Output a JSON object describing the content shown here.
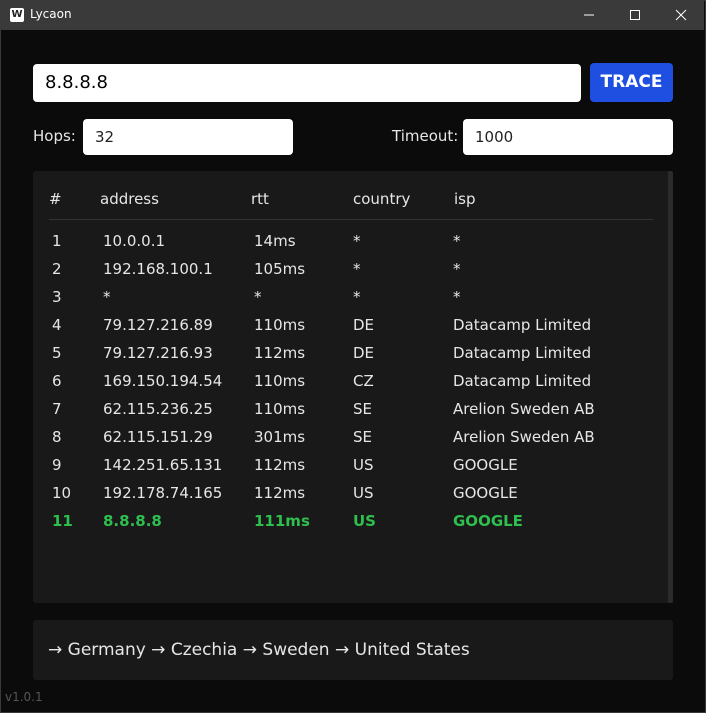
{
  "window": {
    "title": "Lycaon",
    "icon_letter": "W",
    "controls": [
      "minimize-icon",
      "maximize-icon",
      "close-icon"
    ]
  },
  "search": {
    "value": "8.8.8.8",
    "button_label": "TRACE"
  },
  "options": {
    "hops_label": "Hops:",
    "hops_value": "32",
    "timeout_label": "Timeout:",
    "timeout_value": "1000"
  },
  "table": {
    "headers": [
      "#",
      "address",
      "rtt",
      "country",
      "isp"
    ],
    "rows": [
      {
        "num": "1",
        "address": "10.0.0.1",
        "rtt": "14ms",
        "country": "*",
        "isp": "*"
      },
      {
        "num": "2",
        "address": "192.168.100.1",
        "rtt": "105ms",
        "country": "*",
        "isp": "*"
      },
      {
        "num": "3",
        "address": "*",
        "rtt": "*",
        "country": "*",
        "isp": "*"
      },
      {
        "num": "4",
        "address": "79.127.216.89",
        "rtt": "110ms",
        "country": "DE",
        "isp": "Datacamp Limited"
      },
      {
        "num": "5",
        "address": "79.127.216.93",
        "rtt": "112ms",
        "country": "DE",
        "isp": "Datacamp Limited"
      },
      {
        "num": "6",
        "address": "169.150.194.54",
        "rtt": "110ms",
        "country": "CZ",
        "isp": "Datacamp Limited"
      },
      {
        "num": "7",
        "address": "62.115.236.25",
        "rtt": "110ms",
        "country": "SE",
        "isp": "Arelion Sweden AB"
      },
      {
        "num": "8",
        "address": "62.115.151.29",
        "rtt": "301ms",
        "country": "SE",
        "isp": "Arelion Sweden AB"
      },
      {
        "num": "9",
        "address": "142.251.65.131",
        "rtt": "112ms",
        "country": "US",
        "isp": "GOOGLE"
      },
      {
        "num": "10",
        "address": "192.178.74.165",
        "rtt": "112ms",
        "country": "US",
        "isp": "GOOGLE"
      },
      {
        "num": "11",
        "address": "8.8.8.8",
        "rtt": "111ms",
        "country": "US",
        "isp": "GOOGLE"
      }
    ]
  },
  "route": {
    "text": "→ Germany → Czechia → Sweden → United States"
  },
  "version": "v1.0.1",
  "colors": {
    "accent": "#1f4fe0",
    "destination": "#2fbf4f",
    "titlebar": "#3a3a3a"
  }
}
